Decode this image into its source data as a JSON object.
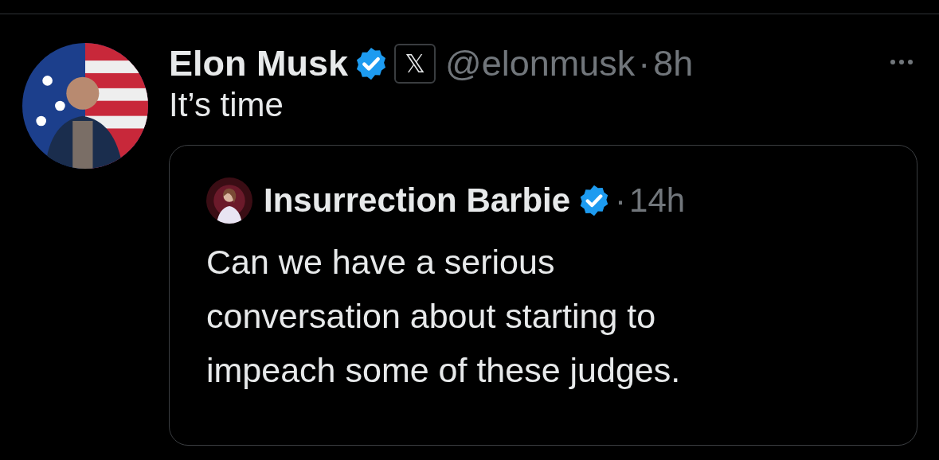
{
  "post": {
    "author": {
      "name": "Elon Musk",
      "verified": true,
      "affiliate_badge": "𝕏",
      "handle": "@elonmusk",
      "separator": "·",
      "time": "8h"
    },
    "more_icon": true,
    "text": "It’s time",
    "quote": {
      "author": {
        "name": "Insurrection Barbie",
        "verified": true,
        "separator": "·",
        "time": "14h"
      },
      "text": "Can we have a serious conversation about starting to impeach some of these judges."
    }
  }
}
